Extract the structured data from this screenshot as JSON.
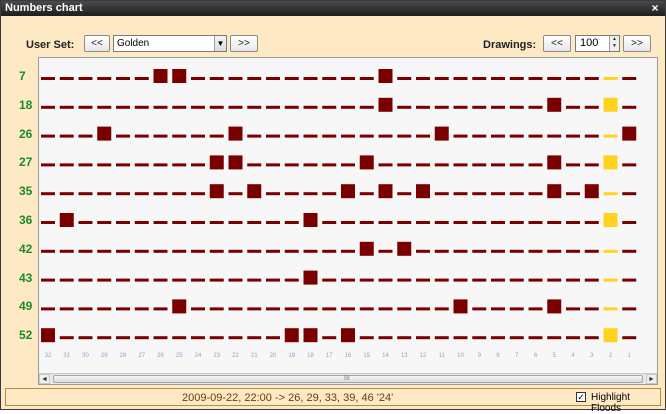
{
  "window": {
    "title": "Numbers chart",
    "close_glyph": "×"
  },
  "toolbar": {
    "user_set_label": "User Set:",
    "prev_set_label": "<<",
    "next_set_label": ">>",
    "selected_set": "Golden",
    "drawings_label": "Drawings:",
    "prev_drawings_label": "<<",
    "next_drawings_label": ">>",
    "drawings_count": "100"
  },
  "chart": {
    "row_numbers": [
      "7",
      "18",
      "26",
      "27",
      "35",
      "36",
      "42",
      "43",
      "49",
      "52"
    ],
    "column_labels": [
      "32",
      "31",
      "30",
      "29",
      "28",
      "27",
      "26",
      "25",
      "24",
      "23",
      "22",
      "21",
      "20",
      "19",
      "18",
      "17",
      "16",
      "15",
      "14",
      "13",
      "12",
      "11",
      "10",
      "9",
      "8",
      "7",
      "6",
      "5",
      "4",
      "3",
      "2",
      "1"
    ],
    "hits": [
      [
        6,
        7,
        18
      ],
      [
        18,
        27
      ],
      [
        3,
        10,
        21,
        31
      ],
      [
        9,
        10,
        17,
        27
      ],
      [
        9,
        11,
        16,
        18,
        20,
        27,
        29
      ],
      [
        1,
        14
      ],
      [
        17,
        19
      ],
      [
        14
      ],
      [
        7,
        22,
        27
      ],
      [
        0,
        13,
        14,
        16
      ]
    ],
    "highlight_column": 30,
    "highlight_rows": [
      1,
      3,
      5,
      9
    ],
    "colors": {
      "hit": "#7a0000",
      "dash": "#7a0000",
      "highlight": "#ffd21c",
      "number_label": "#1f8a2a",
      "axis_label": "#8aa6cc"
    }
  },
  "scrollbar": {
    "left_arrow": "◄",
    "right_arrow": "►",
    "grip": "III"
  },
  "status": {
    "draw_info": "2009-09-22,  22:00  ->  26, 29, 33, 39, 46   '24'",
    "highlight_floods_label": "Highlight Floods",
    "highlight_floods_checked": true,
    "check_glyph": "✓"
  }
}
